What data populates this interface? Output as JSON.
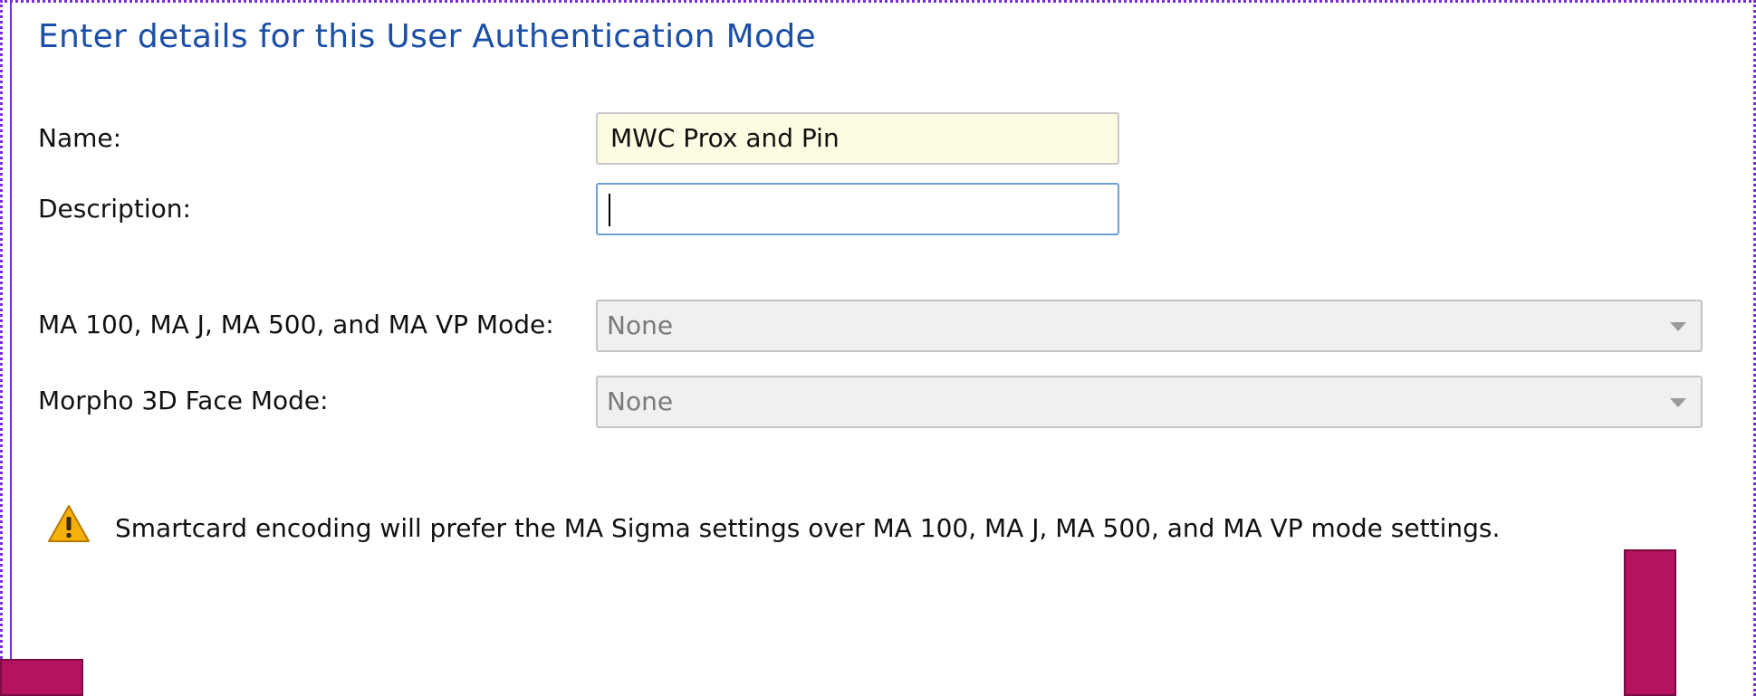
{
  "form": {
    "title": "Enter details for this User Authentication Mode",
    "name_label": "Name:",
    "name_value": "MWC Prox and Pin",
    "description_label": "Description:",
    "description_value": "",
    "ma_mode_label": "MA 100, MA J, MA 500, and MA VP Mode:",
    "ma_mode_value": "None",
    "morpho_label": "Morpho 3D Face Mode:",
    "morpho_value": "None"
  },
  "warning": {
    "icon": "warning-triangle-icon",
    "text": "Smartcard encoding will prefer the MA Sigma settings over MA 100, MA J, MA 500, and MA VP mode settings."
  },
  "colors": {
    "title": "#1c4fa8",
    "frame_border": "#7b2be0",
    "name_field_bg": "#fdfce2",
    "overlay_block": "#b3135f",
    "warning_fill": "#f5b10a"
  }
}
